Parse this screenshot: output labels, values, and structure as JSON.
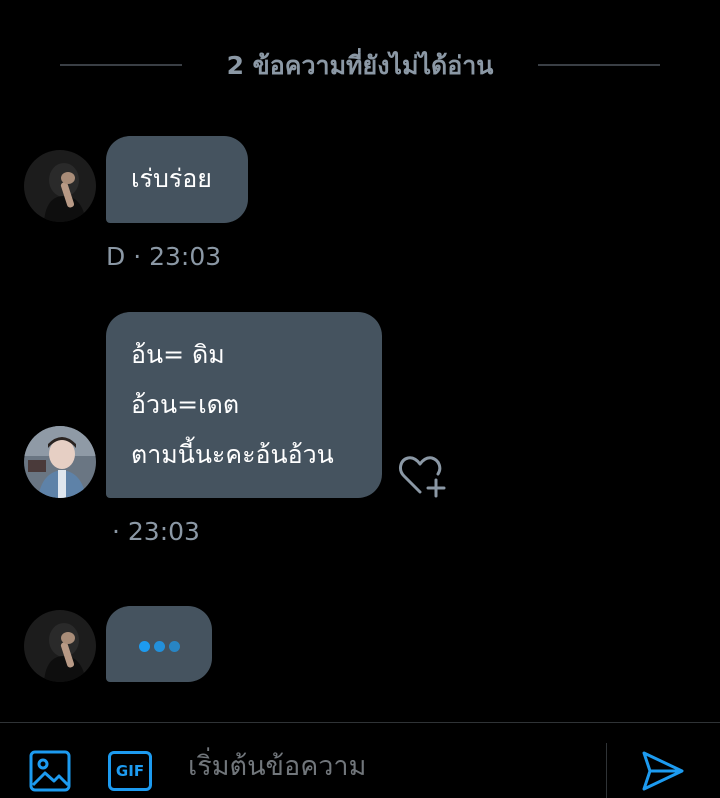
{
  "unread_divider": {
    "text": "2 ข้อความที่ยังไม่ได้อ่าน"
  },
  "messages": [
    {
      "lines": [
        "เร่บร่อย"
      ],
      "meta": "D · 23:03"
    },
    {
      "lines": [
        "อ้น= ดิม",
        "อ้วน=เดต",
        "ตามนี้นะคะอ้นอ้วน"
      ],
      "meta": "· 23:03"
    }
  ],
  "typing_indicator": {
    "dots": 3
  },
  "composer": {
    "placeholder": "เริ่มต้นข้อความ",
    "gif_label": "GIF"
  },
  "colors": {
    "background": "#000000",
    "bubble": "#45535f",
    "accent": "#1d9bf0",
    "muted_text": "#8b98a5"
  },
  "icons": {
    "image": "image-icon",
    "gif": "gif-icon",
    "send": "send-icon",
    "heart_add": "heart-plus-icon"
  }
}
